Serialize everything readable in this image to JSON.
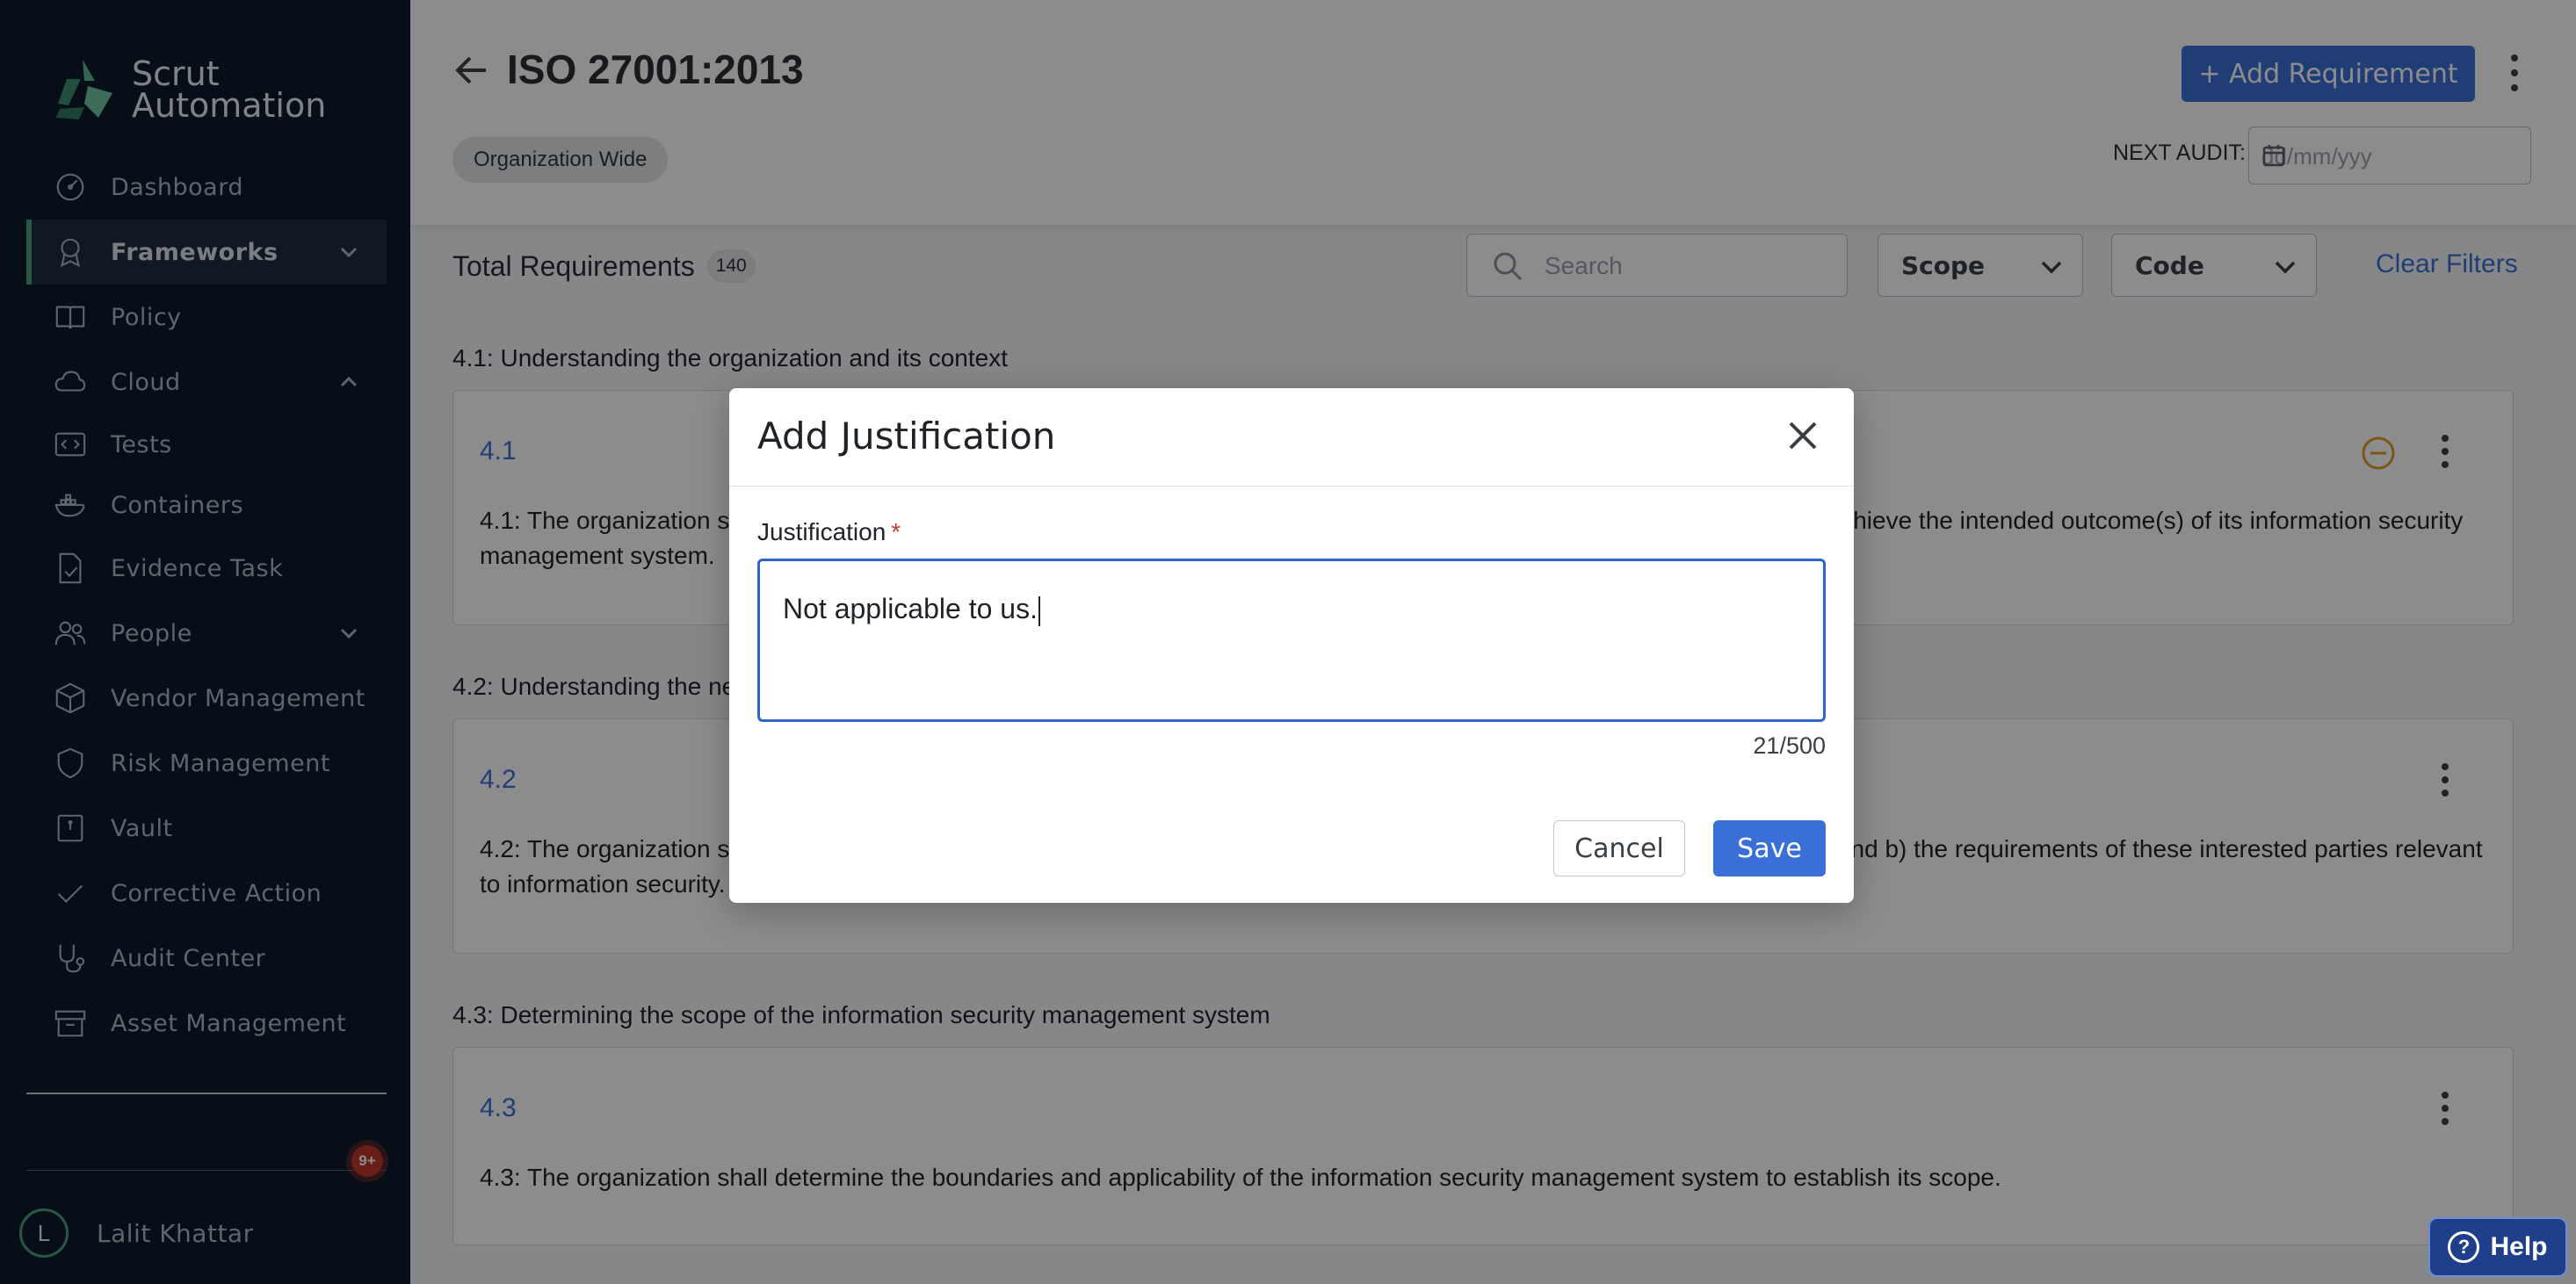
{
  "app": {
    "brand_line1": "Scrut",
    "brand_line2": "Automation",
    "accent_color": "#3b6fd8",
    "brand_green": "#4aa381"
  },
  "sidebar": {
    "items": [
      {
        "label": "Dashboard",
        "icon": "dashboard-icon"
      },
      {
        "label": "Frameworks",
        "icon": "award-icon",
        "active": true,
        "expandable": "chevron-down-icon"
      },
      {
        "label": "Policy",
        "icon": "book-icon"
      },
      {
        "label": "Cloud",
        "icon": "cloud-icon",
        "expandable": "chevron-up-icon"
      },
      {
        "label": "Tests",
        "icon": "code-icon"
      },
      {
        "label": "Containers",
        "icon": "docker-icon"
      },
      {
        "label": "Evidence Task",
        "icon": "file-check-icon"
      },
      {
        "label": "People",
        "icon": "people-icon",
        "expandable": "chevron-down-icon"
      },
      {
        "label": "Vendor Management",
        "icon": "box-icon"
      },
      {
        "label": "Risk Management",
        "icon": "shield-icon"
      },
      {
        "label": "Vault",
        "icon": "vault-icon"
      },
      {
        "label": "Corrective Action",
        "icon": "check-icon"
      },
      {
        "label": "Audit Center",
        "icon": "stethoscope-icon"
      },
      {
        "label": "Asset Management",
        "icon": "archive-icon"
      }
    ],
    "notification_count": "9+",
    "user": {
      "initial": "L",
      "name": "Lalit Khattar"
    }
  },
  "header": {
    "title": "ISO 27001:2013",
    "scope_chip": "Organization Wide",
    "add_button": "+ Add Requirement",
    "next_audit_label": "NEXT AUDIT:",
    "date_placeholder": "dd/mm/yyy"
  },
  "toolbar": {
    "total_label": "Total Requirements",
    "total_count": "140",
    "search_placeholder": "Search",
    "scope_select": "Scope",
    "code_select": "Code",
    "clear_filters": "Clear Filters"
  },
  "requirements": [
    {
      "section": "4.1: Understanding the organization and its context",
      "code": "4.1",
      "description": "4.1: The organization shall determine external and internal issues that are relevant to its purpose and that affect its ability to achieve the intended outcome(s) of its information security management system."
    },
    {
      "section": "4.2: Understanding the needs and expectations of interested parties",
      "code": "4.2",
      "description": "4.2: The organization shall determine: a) interested parties that are relevant to the information security management system; and b) the requirements of these interested parties relevant to information security."
    },
    {
      "section": "4.3: Determining the scope of the information security management system",
      "code": "4.3",
      "description": "4.3: The organization shall determine the boundaries and applicability of the information security management system to establish its scope."
    }
  ],
  "modal": {
    "title": "Add Justification",
    "field_label": "Justification",
    "required_mark": "*",
    "value": "Not applicable to us.",
    "counter": "21/500",
    "cancel": "Cancel",
    "save": "Save"
  },
  "help": {
    "label": "Help"
  }
}
